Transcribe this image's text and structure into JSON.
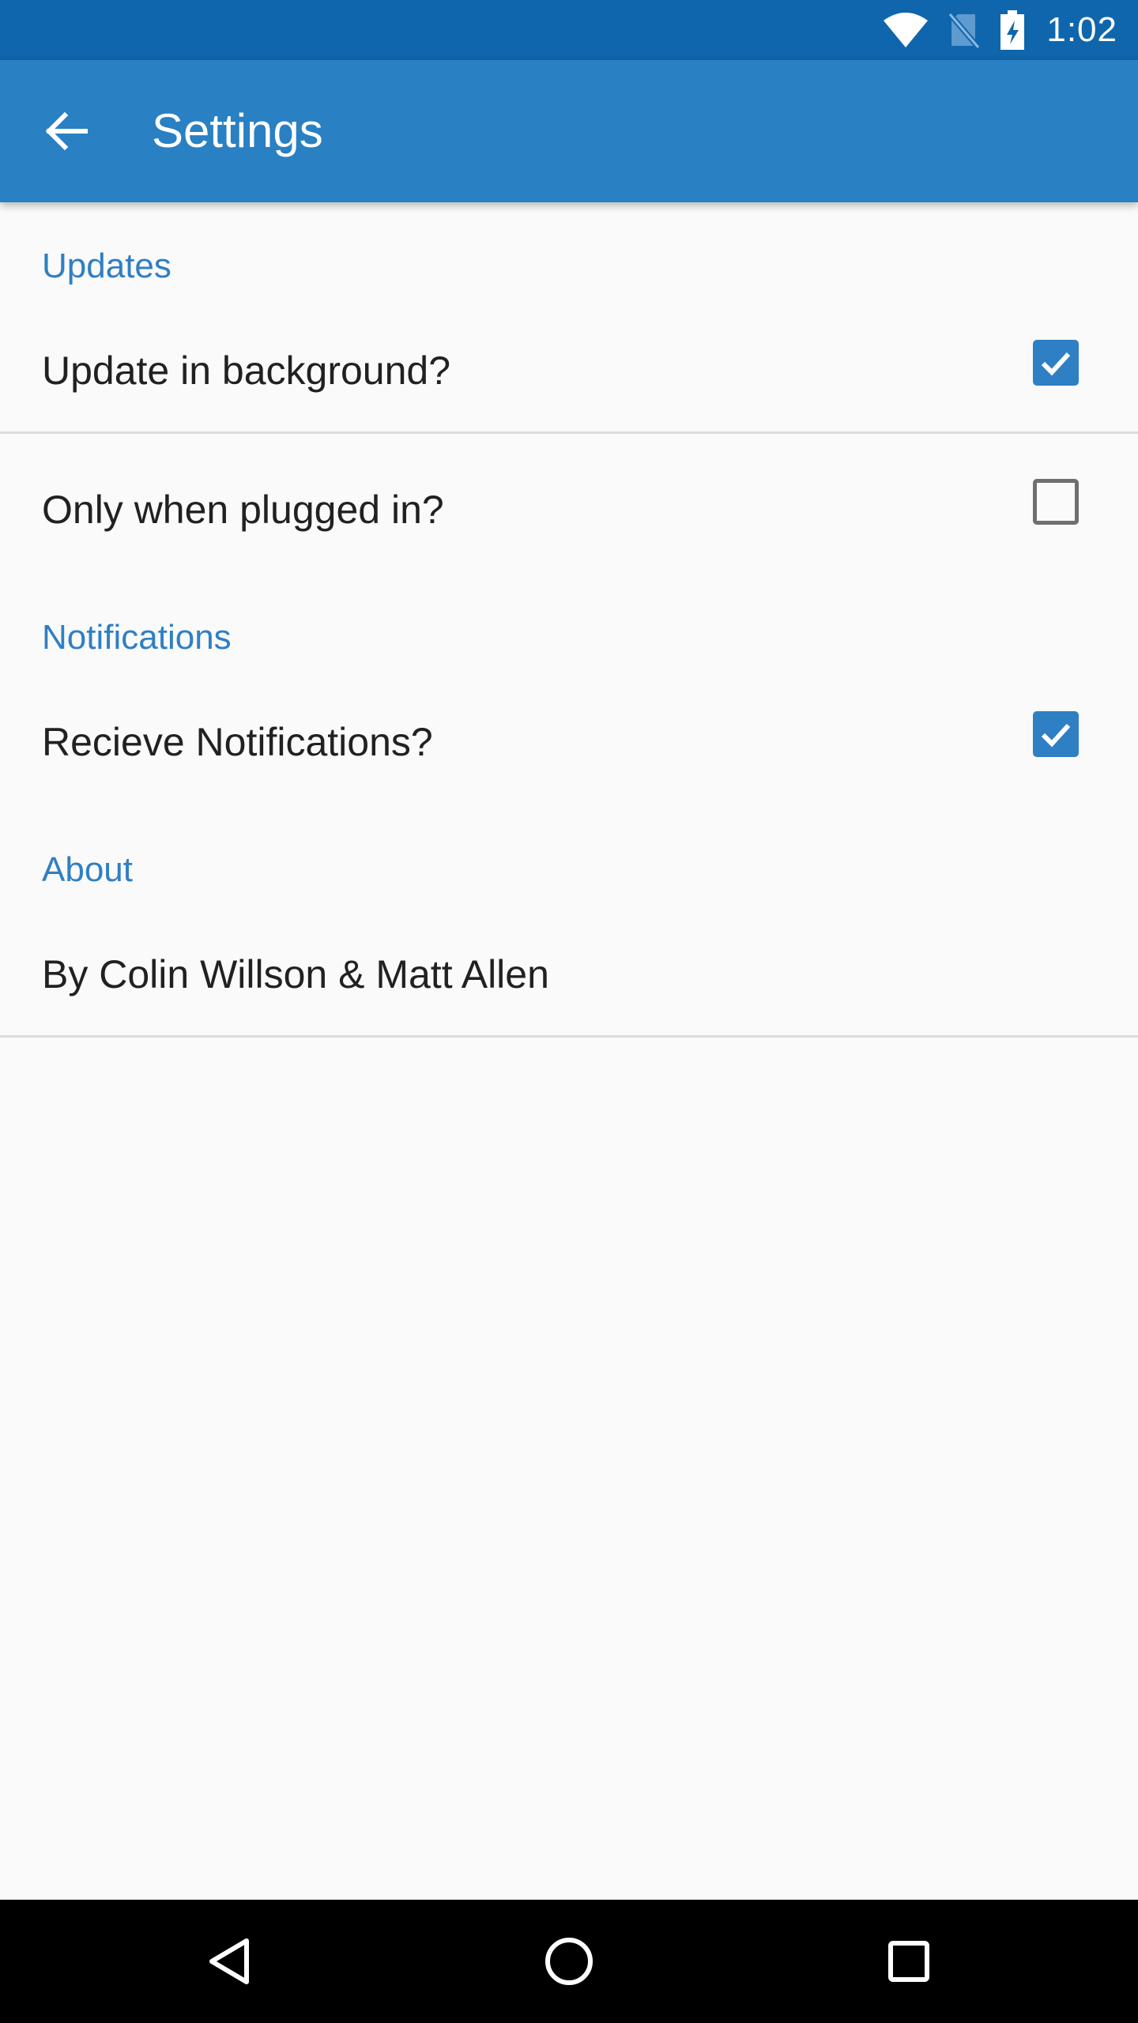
{
  "status_bar": {
    "time": "1:02",
    "icons": [
      "wifi-icon",
      "no-sim-icon",
      "battery-charging-icon"
    ]
  },
  "app_bar": {
    "back_icon": "arrow-back-icon",
    "title": "Settings"
  },
  "sections": {
    "updates": {
      "header": "Updates",
      "update_in_background": {
        "label": "Update in background?",
        "checked": true
      },
      "only_when_plugged_in": {
        "label": "Only when plugged in?",
        "checked": false
      }
    },
    "notifications": {
      "header": "Notifications",
      "receive_notifications": {
        "label": "Recieve Notifications?",
        "checked": true
      }
    },
    "about": {
      "header": "About",
      "credits": "By Colin Willson & Matt Allen"
    }
  },
  "nav_bar": {
    "icons": [
      "back-triangle-icon",
      "home-circle-icon",
      "recents-square-icon"
    ]
  },
  "colors": {
    "status_bar": "#0f66ac",
    "app_bar": "#2980c3",
    "accent": "#2f7fc4",
    "background": "#fafafa"
  }
}
